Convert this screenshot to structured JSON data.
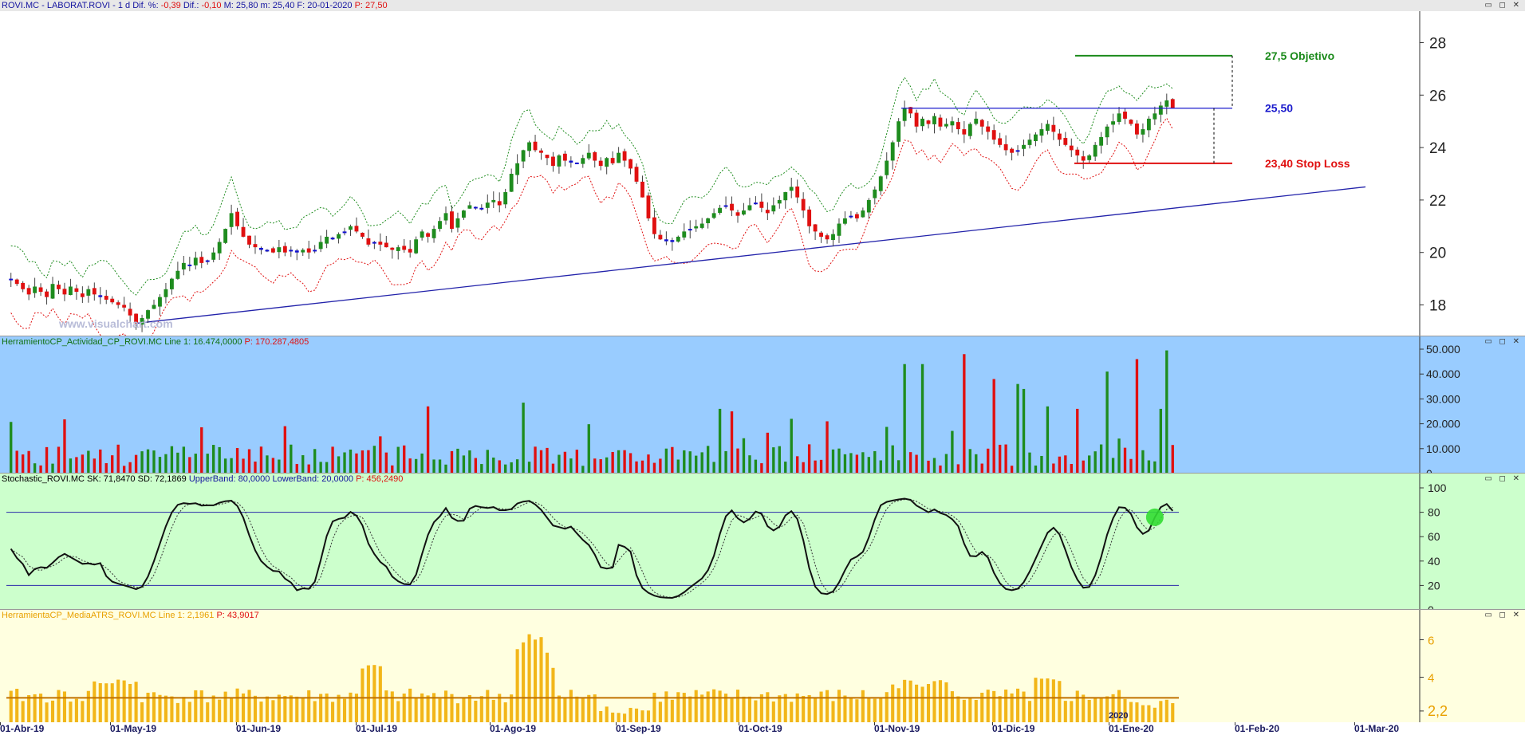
{
  "header": {
    "symbol": "ROVI.MC - LABORAT.ROVI - 1 d",
    "dif_pct_label": "Dif. %:",
    "dif_pct": "-0,39",
    "dif_label": "Dif.:",
    "dif": "-0,10",
    "max_label": "M:",
    "max": "25,80",
    "min_label": "m:",
    "min": "25,40",
    "date_label": "F:",
    "date": "20-01-2020",
    "price_label": "P:",
    "price": "27,50"
  },
  "watermark": "www.visualchart.com",
  "panes": {
    "volume": {
      "name": "HerramientoCP_Actividad_CP_ROVI.MC",
      "line_label": "Line 1:",
      "line": "16.474,0000",
      "p_label": "P:",
      "p": "170.287,4805"
    },
    "stochastic": {
      "name": "Stochastic_ROVI.MC",
      "sk_label": "SK:",
      "sk": "71,8470",
      "sd_label": "SD:",
      "sd": "72,1869",
      "ub_label": "UpperBand:",
      "ub": "80,0000",
      "lb_label": "LowerBand:",
      "lb": "20,0000",
      "p_label": "P:",
      "p": "456,2490"
    },
    "atr": {
      "name": "HerramientaCP_MediaATRS_ROVI.MC",
      "line_label": "Line 1:",
      "line": "2,1961",
      "p_label": "P:",
      "p": "43,9017"
    }
  },
  "x_axis_labels": [
    "01-Abr-19",
    "01-May-19",
    "01-Jun-19",
    "01-Jul-19",
    "01-Ago-19",
    "01-Sep-19",
    "01-Oct-19",
    "01-Nov-19",
    "01-Dic-19",
    "01-Ene-20",
    "01-Feb-20",
    "01-Mar-20"
  ],
  "year_marker": "2020",
  "colors": {
    "up": "#1e8c1e",
    "down": "#e01010",
    "neutral": "#1010d0",
    "upper_band": "#1e8c1e",
    "lower_band": "#e01010",
    "trendline": "#2222aa",
    "atr_bar": "#f2b619",
    "atr_line": "#c07000"
  },
  "chart_data": [
    {
      "type": "candlestick",
      "pane": "price",
      "ylim": [
        16.8,
        29.2
      ],
      "y_ticks": [
        "28",
        "26",
        "24",
        "22",
        "20",
        "18"
      ],
      "annotations": [
        {
          "label": "27,5 Objetivo",
          "value": 27.5,
          "color": "#1a8a1a"
        },
        {
          "label": "25,50",
          "value": 25.5,
          "color": "#1a1acc"
        },
        {
          "label": "23,40 Stop Loss",
          "value": 23.4,
          "color": "#e01010"
        }
      ],
      "closes": [
        19.0,
        18.8,
        18.6,
        18.4,
        18.7,
        18.5,
        18.3,
        18.8,
        18.6,
        18.4,
        18.7,
        18.5,
        18.3,
        18.6,
        18.4,
        18.3,
        18.2,
        18.1,
        18.0,
        17.9,
        17.6,
        17.3,
        17.5,
        17.8,
        18.0,
        18.3,
        18.6,
        19.0,
        19.3,
        19.6,
        19.5,
        19.8,
        19.6,
        19.7,
        20.0,
        20.4,
        20.9,
        21.5,
        21.0,
        20.6,
        20.3,
        20.2,
        20.1,
        20.1,
        20.0,
        20.2,
        20.0,
        20.1,
        20.0,
        20.1,
        20.0,
        20.1,
        20.4,
        20.6,
        20.5,
        20.7,
        20.8,
        21.0,
        20.8,
        20.6,
        20.3,
        20.4,
        20.3,
        20.2,
        20.1,
        20.2,
        20.1,
        20.0,
        20.5,
        20.8,
        20.6,
        20.9,
        21.2,
        21.5,
        20.9,
        21.3,
        21.6,
        21.8,
        21.7,
        21.7,
        21.9,
        22.0,
        21.8,
        22.3,
        23.0,
        23.4,
        23.9,
        24.2,
        23.9,
        23.8,
        23.6,
        23.3,
        23.7,
        23.5,
        23.5,
        23.4,
        23.6,
        23.8,
        23.5,
        23.3,
        23.6,
        23.4,
        23.8,
        23.5,
        23.2,
        22.7,
        22.1,
        21.3,
        20.7,
        20.5,
        20.5,
        20.4,
        20.6,
        20.8,
        20.9,
        21.0,
        21.1,
        21.3,
        21.5,
        21.7,
        21.8,
        21.6,
        21.4,
        21.6,
        21.8,
        21.9,
        21.7,
        21.5,
        21.8,
        22.0,
        22.3,
        22.5,
        22.1,
        21.6,
        21.0,
        20.8,
        20.6,
        20.5,
        20.7,
        21.1,
        21.3,
        21.4,
        21.3,
        21.6,
        22.0,
        22.4,
        22.9,
        23.5,
        24.2,
        25.0,
        25.5,
        25.3,
        24.8,
        25.1,
        24.9,
        25.2,
        24.8,
        24.9,
        25.0,
        24.7,
        24.5,
        24.9,
        25.1,
        24.8,
        24.6,
        24.3,
        24.1,
        23.9,
        23.8,
        23.9,
        24.1,
        24.3,
        24.5,
        24.7,
        24.9,
        24.6,
        24.3,
        24.1,
        23.9,
        23.7,
        23.5,
        23.7,
        24.1,
        24.4,
        24.8,
        25.0,
        25.3,
        25.1,
        24.9,
        24.5,
        24.7,
        25.1,
        25.3,
        25.6,
        25.8,
        25.5
      ],
      "stochastic": {
        "ylim": [
          0,
          100
        ],
        "y_ticks": [
          "100",
          "80",
          "60",
          "40",
          "20",
          "0"
        ],
        "upper_band": 80,
        "lower_band": 20
      },
      "volume": {
        "ylim": [
          0,
          50000
        ],
        "y_ticks": [
          "50.000",
          "40.000",
          "30.000",
          "20.000",
          "10.000",
          "0"
        ]
      },
      "atr": {
        "ylim": [
          1.6,
          7.0
        ],
        "y_ticks": [
          "6",
          "4",
          "2,2"
        ],
        "line_value": 2.9
      }
    }
  ]
}
